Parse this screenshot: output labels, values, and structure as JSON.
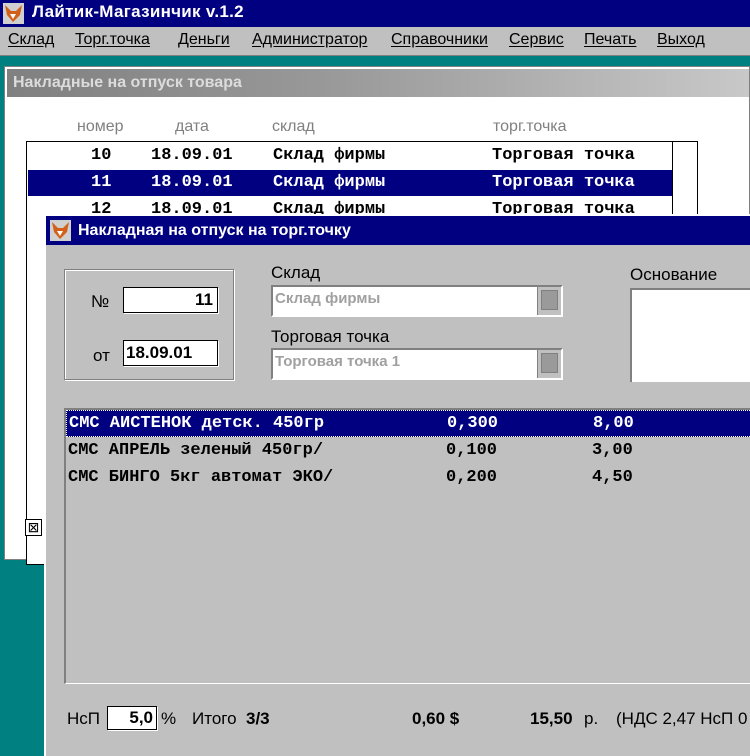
{
  "app": {
    "title": "Лайтик-Магазинчик v.1.2"
  },
  "menu": [
    "Склад",
    "Торг.точка",
    "Деньги",
    "Администратор",
    "Справочники",
    "Сервис",
    "Печать",
    "Выход"
  ],
  "list_window": {
    "title": "Накладные на отпуск товара",
    "columns": [
      "номер",
      "дата",
      "склад",
      "торг.точка"
    ],
    "rows": [
      {
        "number": "10",
        "date": "18.09.01",
        "warehouse": "Склад фирмы",
        "outlet": "Торговая точка"
      },
      {
        "number": "11",
        "date": "18.09.01",
        "warehouse": "Склад фирмы",
        "outlet": "Торговая точка"
      },
      {
        "number": "12",
        "date": "18.09.01",
        "warehouse": "Склад фирмы",
        "outlet": "Торговая точка"
      }
    ],
    "checkbox_glyph": "⊠"
  },
  "dialog": {
    "title": "Накладная на отпуск на торг.точку",
    "number_label": "№",
    "number_value": "11",
    "date_label": "от",
    "date_value": "18.09.01",
    "warehouse_label": "Склад",
    "warehouse_value": "Склад фирмы",
    "outlet_label": "Торговая точка",
    "outlet_value": "Торговая точка 1",
    "basis_label": "Основание",
    "items": [
      {
        "name": "СМС АИСТЕНОК детск. 450гр",
        "qty": "0,300",
        "price": "8,00"
      },
      {
        "name": "СМС АПРЕЛЬ  зеленый 450гр/",
        "qty": "0,100",
        "price": "3,00"
      },
      {
        "name": "СМС БИНГО 5кг автомат ЭКО/",
        "qty": "0,200",
        "price": "4,50"
      }
    ],
    "footer": {
      "nsp_label": "НсП",
      "nsp_value": "5,0",
      "percent": "%",
      "total_label": "Итого",
      "total_count": "3/3",
      "sum_usd": "0,60 $",
      "sum_rub": "15,50",
      "rub_unit": "р.",
      "vat_text": "(НДС 2,47 НсП 0"
    }
  }
}
